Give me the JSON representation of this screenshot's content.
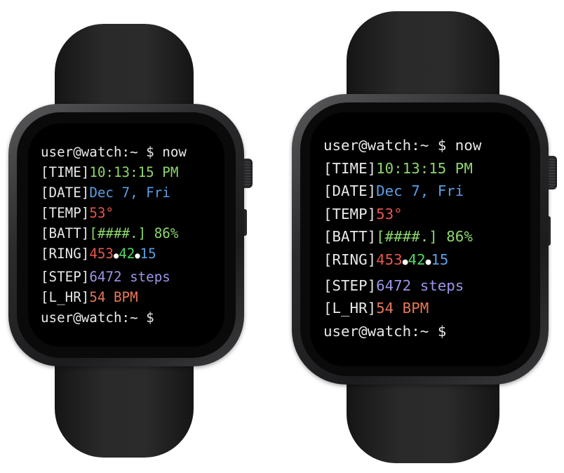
{
  "watches": [
    {
      "prompt_command": "user@watch:~ $ now",
      "rows": [
        {
          "tag": "[TIME]",
          "value": "10:13:15 PM"
        },
        {
          "tag": "[DATE]",
          "value": "Dec 7, Fri"
        },
        {
          "tag": "[TEMP]",
          "value": "53°"
        },
        {
          "tag": "[BATT]",
          "value": "[####.] 86%"
        },
        {
          "tag": "[RING]",
          "move": "453",
          "exercise": "42",
          "stand": "15",
          "dot": "●"
        },
        {
          "tag": "[STEP]",
          "value": "6472 steps"
        },
        {
          "tag": "[L_HR]",
          "value": "54 BPM"
        }
      ],
      "prompt_end": "user@watch:~ $"
    },
    {
      "prompt_command": "user@watch:~ $ now",
      "rows": [
        {
          "tag": "[TIME]",
          "value": "10:13:15 PM"
        },
        {
          "tag": "[DATE]",
          "value": "Dec 7, Fri"
        },
        {
          "tag": "[TEMP]",
          "value": "53°"
        },
        {
          "tag": "[BATT]",
          "value": "[####.] 86%"
        },
        {
          "tag": "[RING]",
          "move": "453",
          "exercise": "42",
          "stand": "15",
          "dot": "●"
        },
        {
          "tag": "[STEP]",
          "value": "6472 steps"
        },
        {
          "tag": "[L_HR]",
          "value": "54 BPM"
        }
      ],
      "prompt_end": "user@watch:~ $"
    }
  ],
  "colors": {
    "time": "#8dd66c",
    "date": "#5b9ee6",
    "temp": "#e4574c",
    "battery": "#8dd66c",
    "ring_move": "#e4574c",
    "ring_exercise": "#4cd964",
    "ring_stand": "#5b9ee6",
    "steps": "#9a96e8",
    "heart_rate": "#e8765a",
    "screen_bg": "#000000",
    "text": "#e8e8e8"
  }
}
